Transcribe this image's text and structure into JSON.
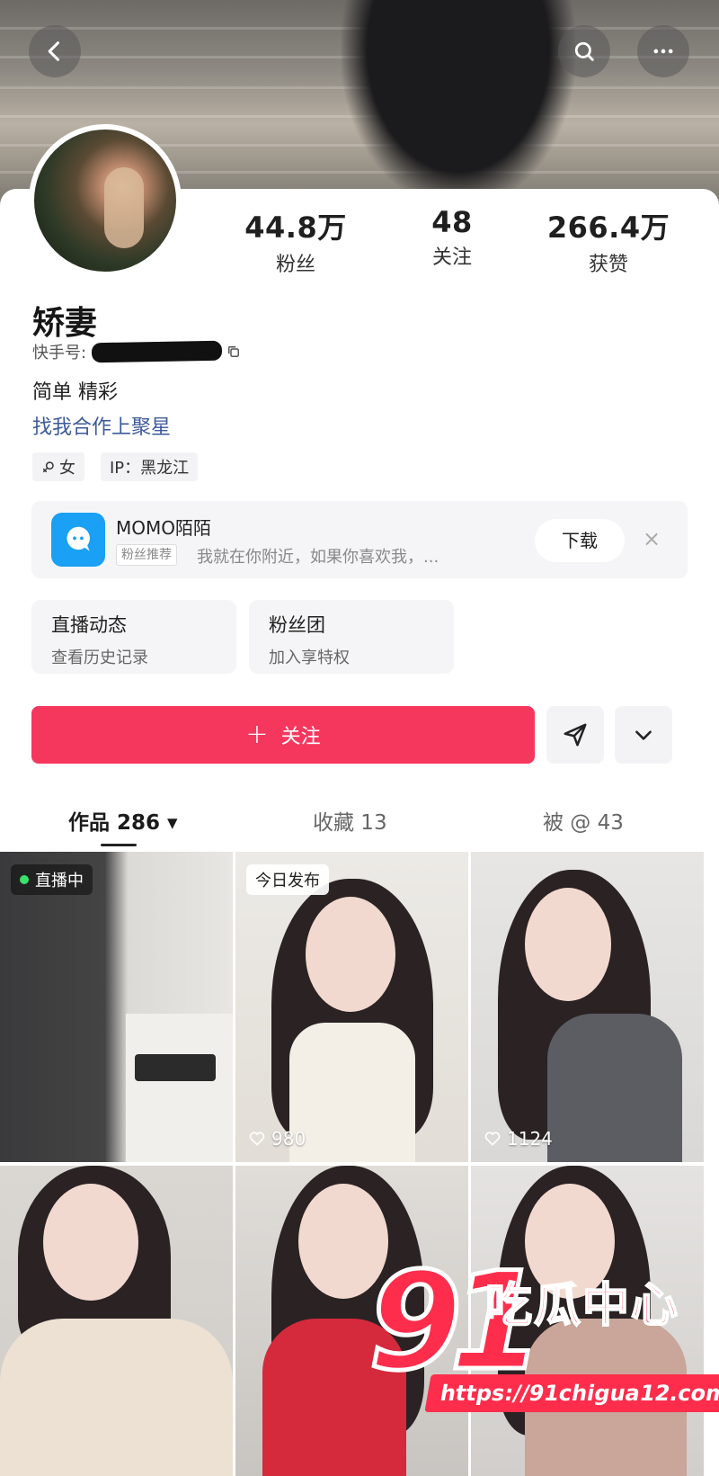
{
  "header": {
    "back_icon": "chevron-left-icon",
    "search_icon": "search-icon",
    "more_icon": "more-icon"
  },
  "profile": {
    "name": "矫妻",
    "kuaishou_id_label": "快手号:",
    "bio": "简单 精彩",
    "cta": "找我合作上聚星",
    "tags": [
      {
        "icon": "female-icon",
        "label": "女"
      },
      {
        "label": "IP：黑龙江"
      }
    ]
  },
  "stats": [
    {
      "value": "44.8万",
      "label": "粉丝"
    },
    {
      "value": "48",
      "label": "关注"
    },
    {
      "value": "266.4万",
      "label": "获赞"
    }
  ],
  "ad": {
    "title": "MOMO陌陌",
    "badge": "粉丝推荐",
    "desc": "我就在你附近，如果你喜欢我，...",
    "download": "下载",
    "close": "×",
    "brand_color": "#1aa0f4"
  },
  "quick_links": [
    {
      "title": "直播动态",
      "sub": "查看历史记录"
    },
    {
      "title": "粉丝团",
      "sub": "加入享特权"
    }
  ],
  "actions": {
    "follow_label": "关注",
    "follow_plus": "+",
    "accent": "#f5375e"
  },
  "tabs": [
    {
      "label": "作品 286 ▾",
      "active": true
    },
    {
      "label": "收藏 13",
      "active": false
    },
    {
      "label": "被 @ 43",
      "active": false
    }
  ],
  "grid": [
    {
      "badge": "直播中",
      "likes": ""
    },
    {
      "badge": "今日发布",
      "likes": "980"
    },
    {
      "badge": "",
      "likes": "1124"
    },
    {
      "badge": "",
      "likes": ""
    },
    {
      "badge": "",
      "likes": ""
    },
    {
      "badge": "",
      "likes": ""
    }
  ],
  "watermark": {
    "number": "91",
    "text": "吃瓜中心",
    "url": "https://91chigua12.com"
  }
}
